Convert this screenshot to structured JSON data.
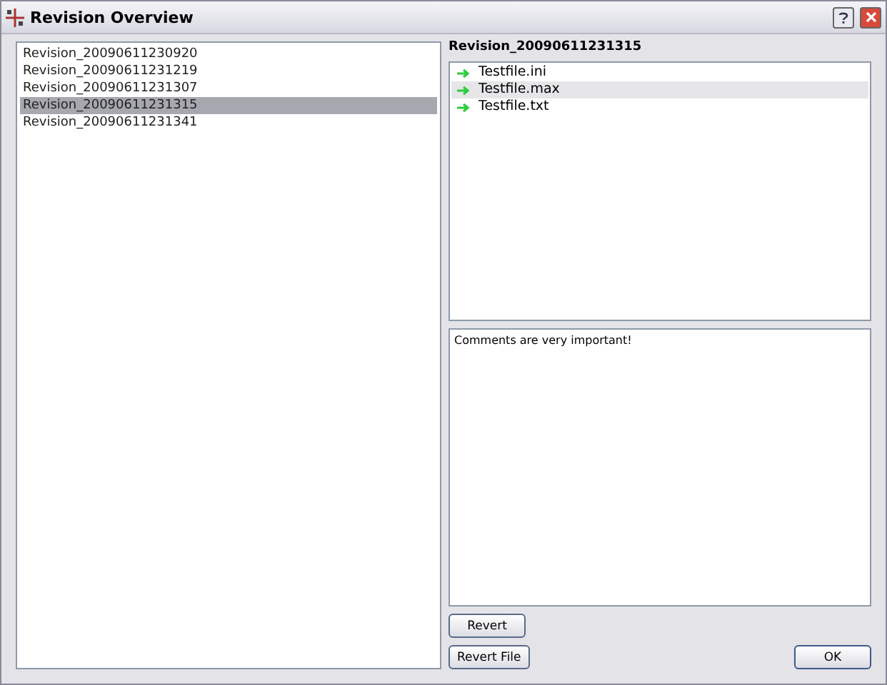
{
  "window": {
    "title": "Revision Overview"
  },
  "revisions": [
    {
      "label": "Revision_20090611230920",
      "selected": false
    },
    {
      "label": "Revision_20090611231219",
      "selected": false
    },
    {
      "label": "Revision_20090611231307",
      "selected": false
    },
    {
      "label": "Revision_20090611231315",
      "selected": true
    },
    {
      "label": "Revision_20090611231341",
      "selected": false
    }
  ],
  "detail": {
    "heading": "Revision_20090611231315",
    "files": [
      {
        "name": "Testfile.ini",
        "selected": false
      },
      {
        "name": "Testfile.max",
        "selected": true
      },
      {
        "name": "Testfile.txt",
        "selected": false
      }
    ],
    "comment": "Comments are very important!"
  },
  "buttons": {
    "revert": "Revert",
    "revert_file": "Revert File",
    "ok": "OK"
  }
}
